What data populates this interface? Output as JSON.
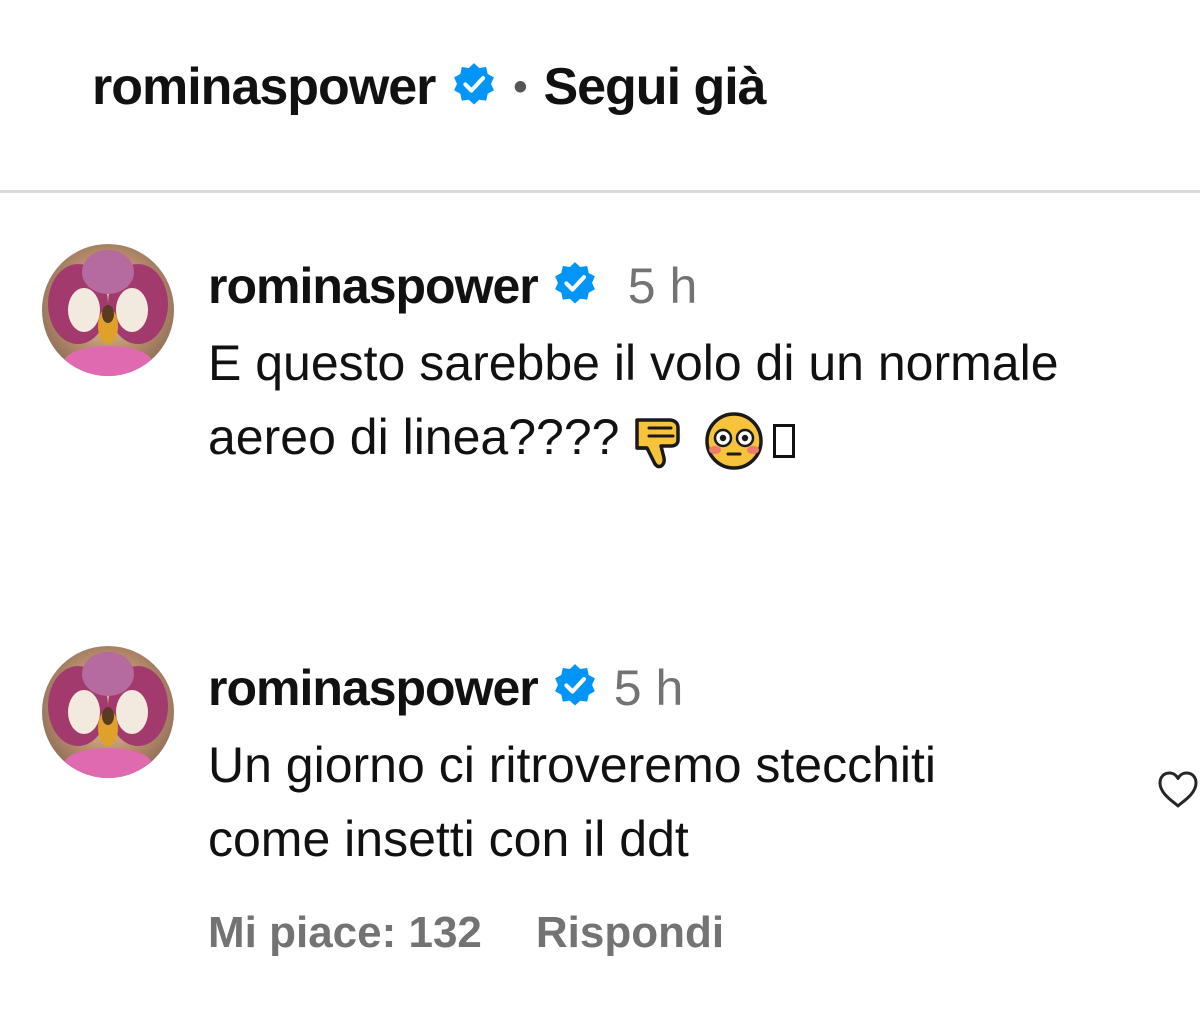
{
  "header": {
    "username": "rominaspower",
    "separator": "•",
    "follow_status": "Segui già"
  },
  "comments": [
    {
      "username": "rominaspower",
      "time": "5 h",
      "lines": [
        "E questo sarebbe il volo di un normale",
        "aereo di linea????"
      ],
      "emojis": [
        "thumbs-down",
        "flushed-face",
        "missing-glyph"
      ]
    },
    {
      "username": "rominaspower",
      "time": "5 h",
      "lines": [
        "Un giorno ci ritroveremo stecchiti",
        "come insetti con il ddt"
      ],
      "likes": "Mi piace: 132",
      "reply": "Rispondi"
    }
  ],
  "colors": {
    "verified": "#0095f6",
    "secondary_text": "#737373",
    "divider": "#dbdbdb",
    "emoji_yellow": "#f7c33b"
  },
  "icons": {
    "verified": "verified-badge-icon",
    "like": "heart-icon"
  }
}
